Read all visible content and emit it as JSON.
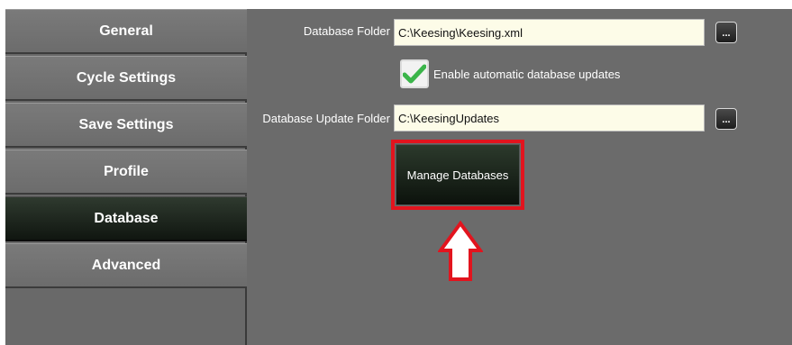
{
  "sidebar": {
    "items": [
      {
        "label": "General",
        "active": false
      },
      {
        "label": "Cycle Settings",
        "active": false
      },
      {
        "label": "Save Settings",
        "active": false
      },
      {
        "label": "Profile",
        "active": false
      },
      {
        "label": "Database",
        "active": true
      },
      {
        "label": "Advanced",
        "active": false
      }
    ]
  },
  "database": {
    "folder_label": "Database Folder",
    "folder_value": "C:\\Keesing\\Keesing.xml",
    "browse_label": "...",
    "auto_update_checked": true,
    "auto_update_label": "Enable automatic database updates",
    "update_folder_label": "Database Update Folder",
    "update_folder_value": "C:\\KeesingUpdates",
    "manage_button_label": "Manage Databases"
  },
  "colors": {
    "highlight": "#e2141e",
    "check": "#3bb54a"
  }
}
